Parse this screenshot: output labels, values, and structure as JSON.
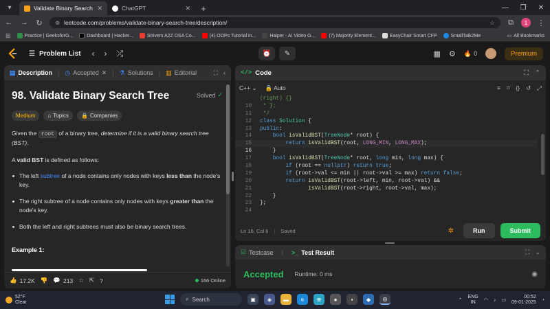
{
  "browser": {
    "tabs": [
      {
        "title": "Validate Binary Search Tree - Le",
        "color": "#ffa116",
        "active": true
      },
      {
        "title": "ChatGPT",
        "color": "#ffffff",
        "active": false
      }
    ],
    "url": "leetcode.com/problems/validate-binary-search-tree/description/",
    "profile_initial": "1",
    "bookmarks": [
      {
        "label": "Practice | GeeksforG...",
        "color": "#2f8d46"
      },
      {
        "label": "Dashboard | Hacker...",
        "color": "#000000"
      },
      {
        "label": "Strivers A2Z DSA Co...",
        "color": "#e63b2e"
      },
      {
        "label": "(4) OOPs Tutorial in...",
        "color": "#ff0000"
      },
      {
        "label": "Haiper - AI Video G...",
        "color": "#444444"
      },
      {
        "label": "(7) Majority Element...",
        "color": "#ff0000"
      },
      {
        "label": "EasyChair Smart CFP",
        "color": "#dddddd"
      },
      {
        "label": "SmallTalk2Me",
        "color": "#1e88e5"
      }
    ],
    "all_bookmarks": "All Bookmarks"
  },
  "topbar": {
    "problem_list": "Problem List",
    "streak": "0",
    "premium": "Premium"
  },
  "left": {
    "tabs": {
      "description": "Description",
      "accepted": "Accepted",
      "solutions": "Solutions",
      "editorial": "Editorial"
    },
    "title": "98. Validate Binary Search Tree",
    "solved": "Solved",
    "chips": {
      "difficulty": "Medium",
      "topics": "Topics",
      "companies": "Companies"
    },
    "intro": {
      "a": "Given the ",
      "code": "root",
      "b": " of a binary tree, ",
      "em": "determine if it is a valid binary search tree (BST)",
      "c": "."
    },
    "def": {
      "a": "A ",
      "strong": "valid BST",
      "b": " is defined as follows:"
    },
    "bullets": [
      {
        "a": "The left ",
        "link": "subtree",
        "b": " of a node contains only nodes with keys ",
        "strong": "less than",
        "c": " the node's key."
      },
      {
        "a": "The right subtree of a node contains only nodes with keys ",
        "strong": "greater than",
        "b": " the node's key."
      },
      {
        "a": "Both the left and right subtrees must also be binary search trees."
      }
    ],
    "example": "Example 1:",
    "footer": {
      "likes": "17.2K",
      "comments": "213",
      "online": "166 Online"
    }
  },
  "editor": {
    "title": "Code",
    "language": "C++",
    "mode": "Auto",
    "lines": [
      {
        "n": "",
        "text": "(right) {}"
      },
      {
        "n": "10",
        "text": " * };"
      },
      {
        "n": "11",
        "text": " */"
      },
      {
        "n": "12",
        "text": "class Solution {"
      },
      {
        "n": "13",
        "text": "public:"
      },
      {
        "n": "14",
        "text": "    bool isValidBST(TreeNode* root) {"
      },
      {
        "n": "15",
        "text": "        return isValidBST(root, LONG_MIN, LONG_MAX);"
      },
      {
        "n": "16",
        "text": "    }"
      },
      {
        "n": "17",
        "text": "    bool isValidBST(TreeNode* root, long min, long max) {"
      },
      {
        "n": "18",
        "text": "        if (root == nullptr) return true;"
      },
      {
        "n": "19",
        "text": "        if (root->val <= min || root->val >= max) return false;"
      },
      {
        "n": "20",
        "text": "        return isValidBST(root->left, min, root->val) &&"
      },
      {
        "n": "21",
        "text": "               isValidBST(root->right, root->val, max);"
      },
      {
        "n": "22",
        "text": "    }"
      },
      {
        "n": "23",
        "text": "};"
      },
      {
        "n": "24",
        "text": ""
      }
    ],
    "status": "Ln 16, Col 6",
    "saved": "Saved",
    "run": "Run",
    "submit": "Submit"
  },
  "testpanel": {
    "testcase": "Testcase",
    "result_tab": "Test Result",
    "status": "Accepted",
    "runtime": "Runtime: 0 ms"
  },
  "taskbar": {
    "temp": "52°F",
    "weather": "Clear",
    "search": "Search",
    "lang1": "ENG",
    "lang2": "IN",
    "time": "00:52",
    "date": "09-01-2025"
  }
}
